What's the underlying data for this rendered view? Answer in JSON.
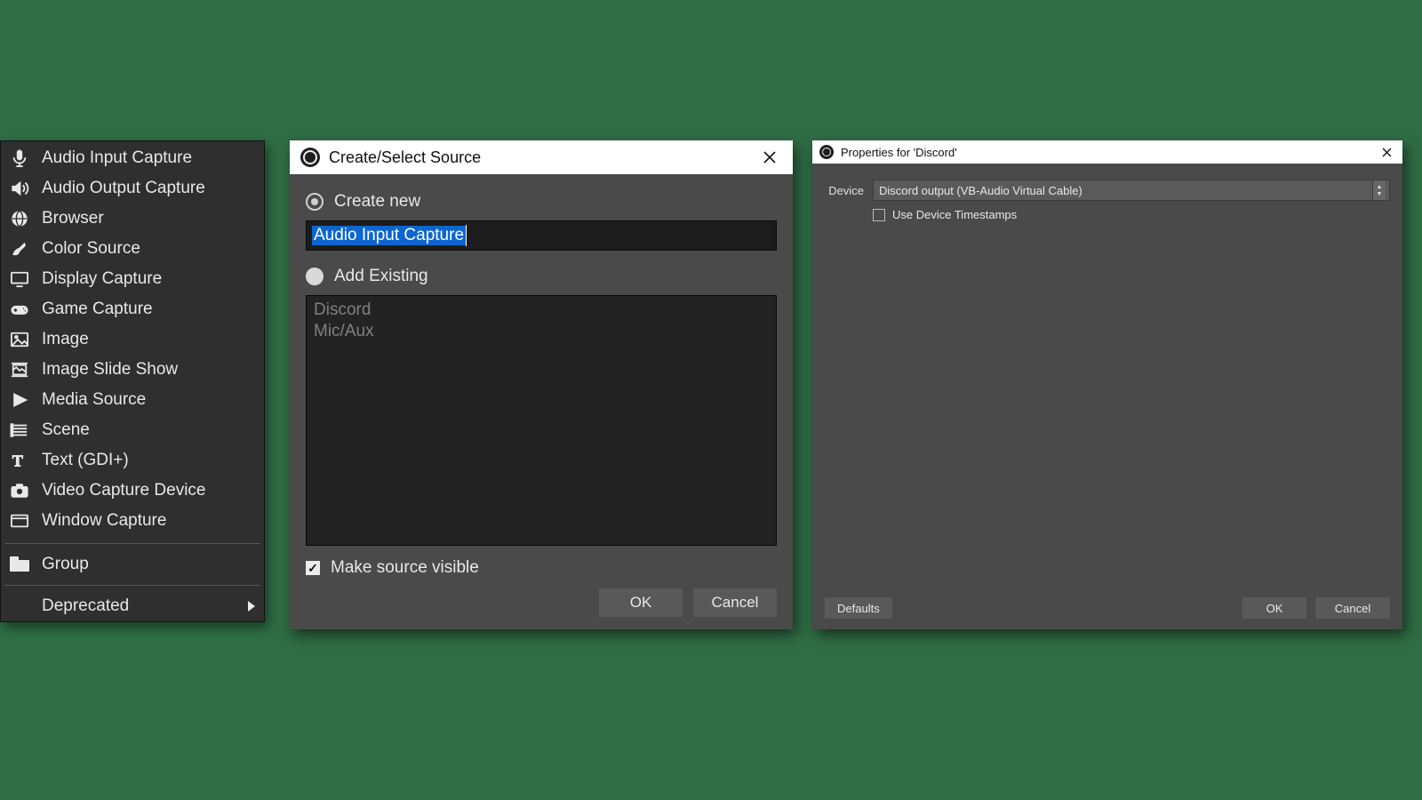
{
  "source_menu": {
    "items": [
      {
        "icon": "mic-icon",
        "label": "Audio Input Capture"
      },
      {
        "icon": "speaker-icon",
        "label": "Audio Output Capture"
      },
      {
        "icon": "globe-icon",
        "label": "Browser"
      },
      {
        "icon": "brush-icon",
        "label": "Color Source"
      },
      {
        "icon": "monitor-icon",
        "label": "Display Capture"
      },
      {
        "icon": "gamepad-icon",
        "label": "Game Capture"
      },
      {
        "icon": "image-icon",
        "label": "Image"
      },
      {
        "icon": "slideshow-icon",
        "label": "Image Slide Show"
      },
      {
        "icon": "play-icon",
        "label": "Media Source"
      },
      {
        "icon": "scene-icon",
        "label": "Scene"
      },
      {
        "icon": "text-icon",
        "label": "Text (GDI+)"
      },
      {
        "icon": "camera-icon",
        "label": "Video Capture Device"
      },
      {
        "icon": "window-icon",
        "label": "Window Capture"
      }
    ],
    "group_label": "Group",
    "deprecated_label": "Deprecated"
  },
  "create_dialog": {
    "title": "Create/Select Source",
    "radio_create": "Create new",
    "radio_existing": "Add Existing",
    "name_value": "Audio Input Capture",
    "existing_items": [
      "Discord",
      "Mic/Aux"
    ],
    "make_visible": "Make source visible",
    "ok": "OK",
    "cancel": "Cancel"
  },
  "props_dialog": {
    "title": "Properties for 'Discord'",
    "device_label": "Device",
    "device_value": "Discord output (VB-Audio Virtual Cable)",
    "use_ts": "Use Device Timestamps",
    "defaults": "Defaults",
    "ok": "OK",
    "cancel": "Cancel"
  }
}
